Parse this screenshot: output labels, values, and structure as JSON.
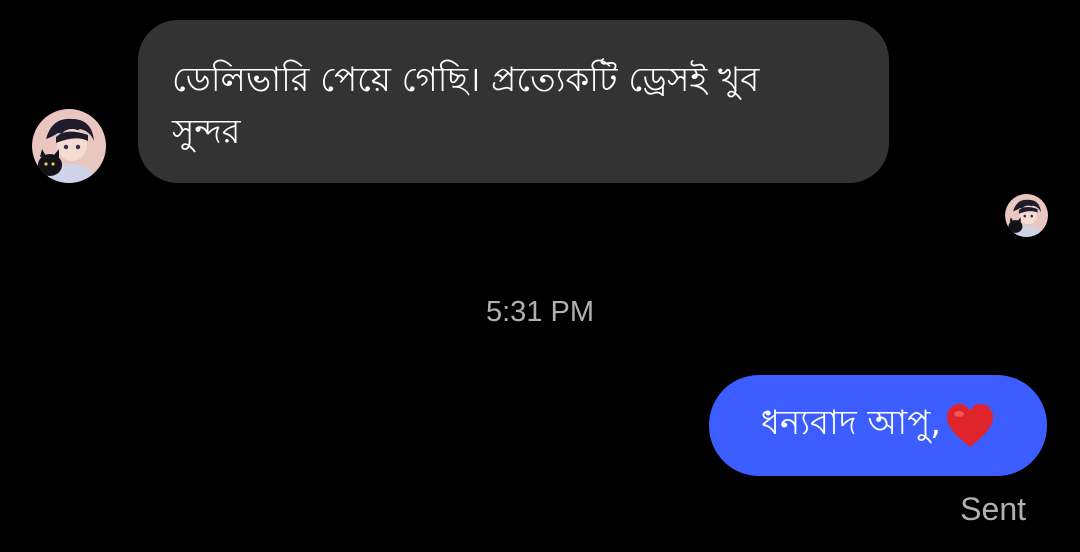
{
  "thread": {
    "incoming_message": {
      "text": "ডেলিভারি পেয়ে গেছি। প্রত্যেকটি ড্রেসই খুব সুন্দর",
      "avatar_icon": "profile-avatar-icon"
    },
    "seen_avatar_icon": "seen-avatar-icon",
    "timestamp": "5:31 PM",
    "outgoing_message": {
      "text": "ধন্যবাদ আপু,",
      "emoji_icon": "red-heart-emoji-icon",
      "status": "Sent"
    }
  },
  "colors": {
    "background": "#000000",
    "incoming_bubble": "#333333",
    "outgoing_bubble": "#3c5dff",
    "meta_text": "#b0b0b0",
    "heart": "#e0242b"
  }
}
